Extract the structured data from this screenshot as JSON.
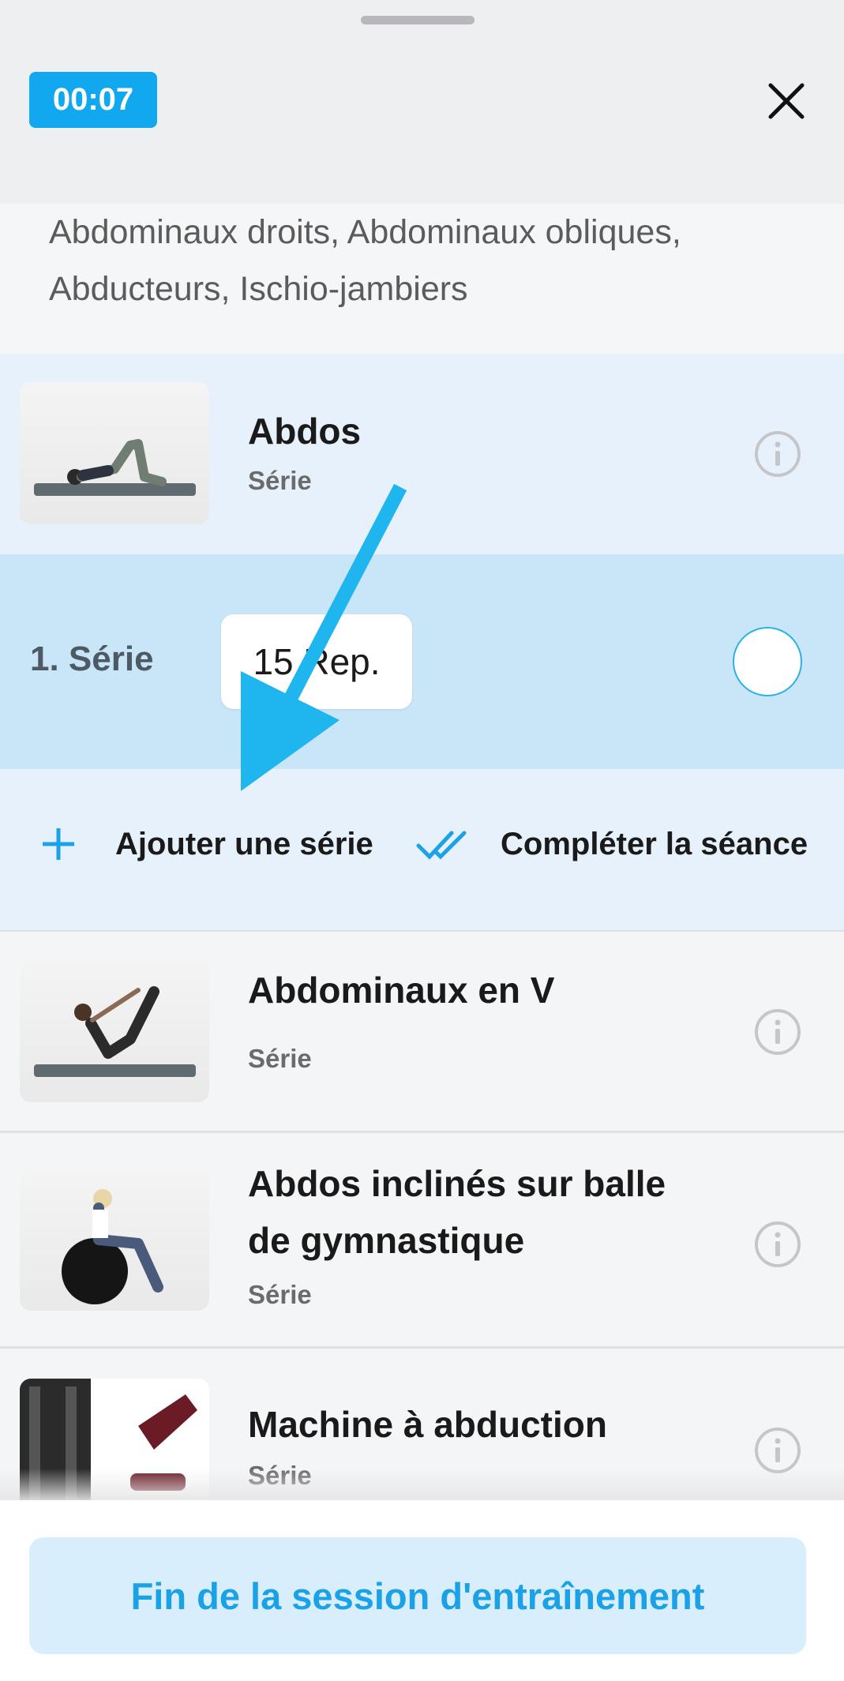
{
  "header": {
    "timer": "00:07",
    "close_icon": "close-icon"
  },
  "muscles": {
    "text": "Abdominaux droits, Abdominaux obliques, Abducteurs, Ischio-jambiers"
  },
  "exercises": [
    {
      "name": "Abdos",
      "subtitle": "Série",
      "icon": "info-icon"
    },
    {
      "name": "Abdominaux en V",
      "subtitle": "Série",
      "icon": "info-icon"
    },
    {
      "name": "Abdos inclinés sur balle de gymnastique",
      "subtitle": "Série",
      "icon": "info-icon"
    },
    {
      "name": "Machine à abduction",
      "subtitle": "Série",
      "icon": "info-icon"
    }
  ],
  "active_set": {
    "label": "1. Série",
    "reps": "15 Rep."
  },
  "actions": {
    "add_set": "Ajouter une série",
    "complete": "Compléter la séance"
  },
  "footer": {
    "end_button": "Fin de la session d'entraînement"
  },
  "colors": {
    "accent": "#12a8f0",
    "arrow": "#1fb5ee",
    "active_bg": "#c9e5f8"
  }
}
